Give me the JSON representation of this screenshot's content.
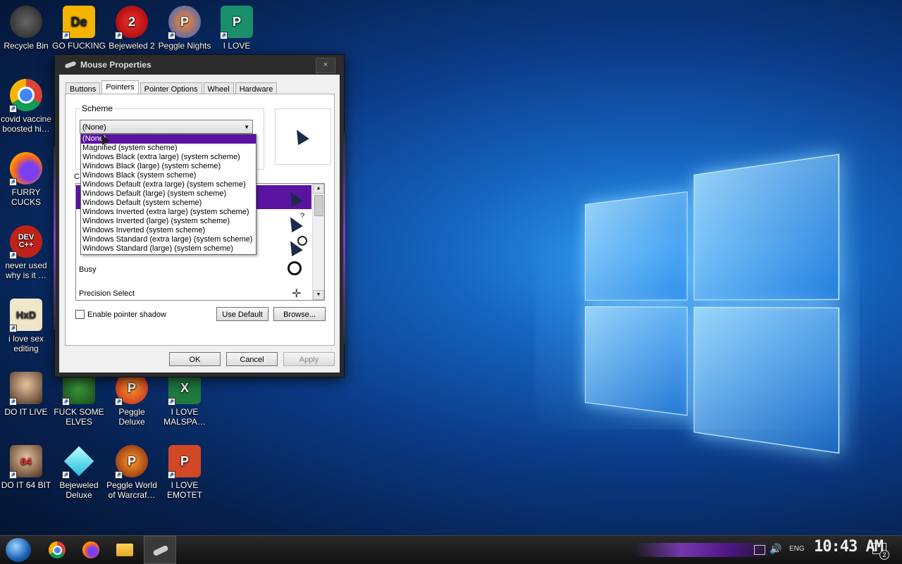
{
  "desktop": {
    "icons": [
      {
        "label": "Recycle Bin",
        "icon": "recycle-bin-icon"
      },
      {
        "label": "GO FUCKING",
        "icon": "de-app-icon",
        "glyph": "De"
      },
      {
        "label": "Bejeweled 2",
        "icon": "bejeweled-2-icon",
        "glyph": "2"
      },
      {
        "label": "Peggle Nights",
        "icon": "peggle-nights-icon",
        "glyph": "P"
      },
      {
        "label": "I LOVE",
        "icon": "publisher-icon",
        "glyph": "P"
      },
      {
        "label": "covid vaccine boosted hi…",
        "icon": "chrome-icon"
      },
      {
        "label": "FURRY CUCKS",
        "icon": "firefox-icon"
      },
      {
        "label": "never used why is it …",
        "icon": "dev-cpp-icon",
        "glyph": "DEV C++"
      },
      {
        "label": "i love sex editing",
        "icon": "hxd-icon",
        "glyph": "HxD"
      },
      {
        "label": "DO IT LIVE",
        "icon": "portrait-icon"
      },
      {
        "label": "FUCK SOME ELVES",
        "icon": "elf-game-icon"
      },
      {
        "label": "Peggle Deluxe",
        "icon": "peggle-deluxe-icon",
        "glyph": "P"
      },
      {
        "label": "I LOVE MALSPA…",
        "icon": "excel-icon",
        "glyph": "X"
      },
      {
        "label": "DO IT 64 BIT",
        "icon": "portrait-64-icon",
        "glyph": "64"
      },
      {
        "label": "Bejeweled Deluxe",
        "icon": "bejeweled-deluxe-icon"
      },
      {
        "label": "Peggle World of Warcraf…",
        "icon": "peggle-wow-icon",
        "glyph": "P"
      },
      {
        "label": "I LOVE EMOTET",
        "icon": "powerpoint-icon",
        "glyph": "P"
      }
    ]
  },
  "window": {
    "title": "Mouse Properties",
    "close": "×",
    "tabs": [
      "Buttons",
      "Pointers",
      "Pointer Options",
      "Wheel",
      "Hardware"
    ],
    "active_tab": "Pointers",
    "scheme": {
      "label": "Scheme",
      "selected": "(None)",
      "options": [
        "(None)",
        "Magnified (system scheme)",
        "Windows Black (extra large) (system scheme)",
        "Windows Black (large) (system scheme)",
        "Windows Black (system scheme)",
        "Windows Default (extra large) (system scheme)",
        "Windows Default (large) (system scheme)",
        "Windows Default (system scheme)",
        "Windows Inverted (extra large) (system scheme)",
        "Windows Inverted (large) (system scheme)",
        "Windows Inverted (system scheme)",
        "Windows Standard (extra large) (system scheme)",
        "Windows Standard (large) (system scheme)"
      ]
    },
    "customize_label": "C",
    "pointer_rows": [
      {
        "label": "",
        "icon": "arrow-cursor-icon"
      },
      {
        "label": "",
        "icon": "help-cursor-icon"
      },
      {
        "label": "",
        "icon": "working-cursor-icon"
      },
      {
        "label": "Busy",
        "icon": "busy-cursor-icon"
      },
      {
        "label": "Precision Select",
        "icon": "crosshair-cursor-icon"
      }
    ],
    "enable_shadow": "Enable pointer shadow",
    "use_default": "Use Default",
    "browse": "Browse...",
    "ok": "OK",
    "cancel": "Cancel",
    "apply": "Apply"
  },
  "taskbar": {
    "language": "ENG",
    "time": "10:43 AM",
    "notifications": "2"
  },
  "colors": {
    "selection": "#5a13a0",
    "accent_purple": "#8a3fd0"
  }
}
